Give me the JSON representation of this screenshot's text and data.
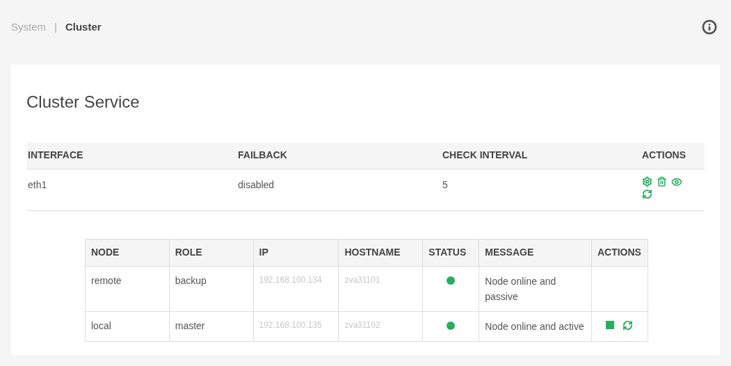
{
  "breadcrumb": {
    "parent": "System",
    "separator": "|",
    "current": "Cluster"
  },
  "title": "Cluster Service",
  "service_table": {
    "columns": [
      "INTERFACE",
      "FAILBACK",
      "CHECK INTERVAL",
      "ACTIONS"
    ],
    "rows": [
      {
        "interface": "eth1",
        "failback": "disabled",
        "check_interval": "5",
        "actions": [
          {
            "kind": "settings"
          },
          {
            "kind": "delete"
          },
          {
            "kind": "view"
          },
          {
            "kind": "restart"
          }
        ]
      }
    ]
  },
  "nodes_table": {
    "columns": [
      "NODE",
      "ROLE",
      "IP",
      "HOSTNAME",
      "STATUS",
      "MESSAGE",
      "ACTIONS"
    ],
    "rows": [
      {
        "node": "remote",
        "role": "backup",
        "ip": "192.168.100.134",
        "hostname": "zva31101",
        "color": "#27ae60",
        "message": "Node online and passive"
      },
      {
        "node": "local",
        "role": "master",
        "ip": "192.168.100.135",
        "hostname": "zva31102",
        "color": "#27ae60",
        "message": "Node online and active",
        "actions": [
          {
            "kind": "stop"
          },
          {
            "kind": "restart"
          }
        ]
      }
    ]
  }
}
